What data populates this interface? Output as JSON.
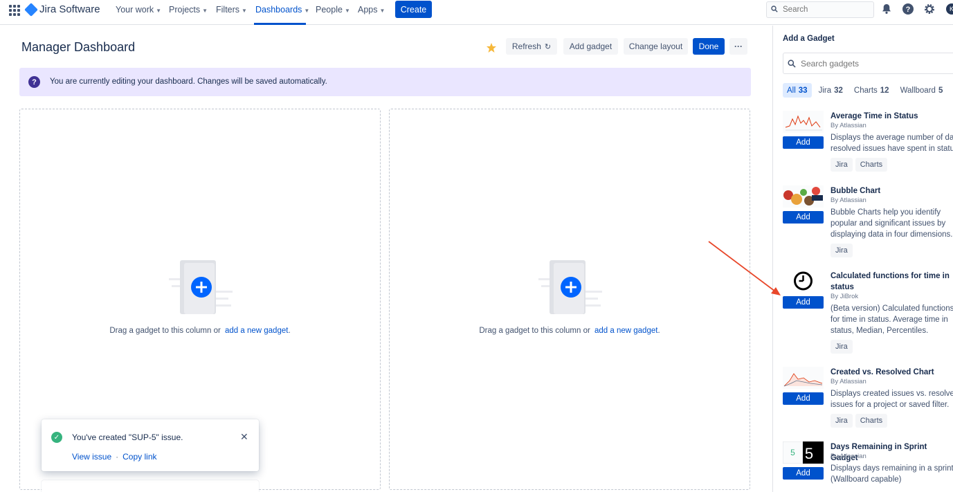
{
  "nav": {
    "product": "Jira Software",
    "items": [
      {
        "label": "Your work"
      },
      {
        "label": "Projects"
      },
      {
        "label": "Filters"
      },
      {
        "label": "Dashboards",
        "active": true
      },
      {
        "label": "People"
      },
      {
        "label": "Apps"
      }
    ],
    "create_label": "Create",
    "search_placeholder": "Search",
    "avatar_initial": "K"
  },
  "header": {
    "title": "Manager Dashboard",
    "refresh_label": "Refresh",
    "add_gadget_label": "Add gadget",
    "change_layout_label": "Change layout",
    "done_label": "Done",
    "more_label": "···"
  },
  "banner": {
    "text": "You are currently editing your dashboard. Changes will be saved automatically."
  },
  "columns": [
    {
      "text": "Drag a gadget to this column or",
      "link": "add a new gadget",
      "suffix": "."
    },
    {
      "text": "Drag a gadget to this column or",
      "link": "add a new gadget",
      "suffix": "."
    }
  ],
  "toast": {
    "message": "You've created \"SUP-5\" issue.",
    "view_link": "View issue",
    "separator": "·",
    "copy_link": "Copy link"
  },
  "panel": {
    "title": "Add a Gadget",
    "search_placeholder": "Search gadgets",
    "filters": [
      {
        "label": "All",
        "count": "33",
        "active": true
      },
      {
        "label": "Jira",
        "count": "32"
      },
      {
        "label": "Charts",
        "count": "12"
      },
      {
        "label": "Wallboard",
        "count": "5"
      }
    ],
    "add_label": "Add",
    "gadgets": [
      {
        "name": "Average Time in Status",
        "by": "By Atlassian",
        "desc": [
          "Displays the average number of days",
          "resolved issues have spent in status"
        ],
        "tags": [
          "Jira",
          "Charts"
        ],
        "thumb": "line-chart-thumbnail"
      },
      {
        "name": "Bubble Chart",
        "by": "By Atlassian",
        "desc": [
          "Bubble Charts help you identify",
          "popular and significant issues by",
          "displaying data in four dimensions."
        ],
        "tags": [
          "Jira"
        ],
        "thumb": "bubble-chart-thumbnail"
      },
      {
        "name": "Calculated functions for time in status",
        "by": "By JiBrok",
        "desc": [
          "(Beta version) Calculated functions",
          "for time in status. Average time in",
          "status, Median, Percentiles."
        ],
        "tags": [
          "Jira"
        ],
        "thumb": "clock-icon"
      },
      {
        "name": "Created vs. Resolved Chart",
        "by": "By Atlassian",
        "desc": [
          "Displays created issues vs. resolved",
          "issues for a project or saved filter."
        ],
        "tags": [
          "Jira",
          "Charts"
        ],
        "thumb": "area-chart-thumbnail"
      },
      {
        "name": "Days Remaining in Sprint Gadget",
        "by": "By Atlassian",
        "desc": [
          "Displays days remaining in a sprint",
          "(Wallboard capable)"
        ],
        "tags": [],
        "thumb": "days-remaining-thumbnail",
        "thumb_value": "5"
      }
    ]
  },
  "colors": {
    "brand": "#0052cc",
    "banner_bg": "#eae6ff",
    "success": "#36b37e",
    "star": "#f6b83a",
    "arrow": "#e8472a"
  }
}
